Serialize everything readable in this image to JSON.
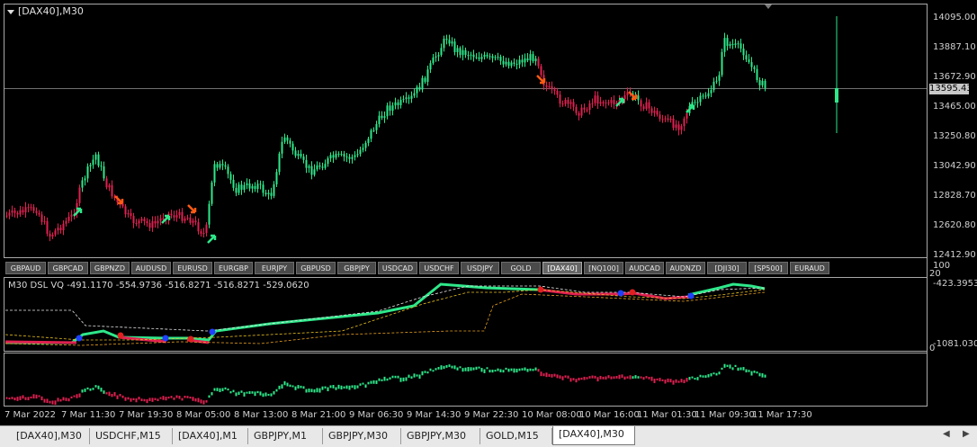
{
  "chart": {
    "title": "[DAX40],M30",
    "price_label": "13595.43",
    "colors": {
      "bull": "#2ee88a",
      "bear": "#e02050",
      "arrow_up": "#2ee88a",
      "arrow_down": "#ff5a14",
      "grid": "#a8a8a8",
      "bg": "#000000"
    }
  },
  "y_axis": {
    "labels": [
      "14095.00",
      "13887.10",
      "13672.90",
      "13465.00",
      "13250.80",
      "13042.90",
      "12828.70",
      "12620.80",
      "12412.90"
    ]
  },
  "symbols": [
    "GBPAUD",
    "GBPCAD",
    "GBPNZD",
    "AUDUSD",
    "EURUSD",
    "EURGBP",
    "EURJPY",
    "GBPUSD",
    "GBPJPY",
    "USDCAD",
    "USDCHF",
    "USDJPY",
    "GOLD",
    "[DAX40]",
    "[NQ100]",
    "AUDCAD",
    "AUDNZD",
    "[DJI30]",
    "[SP500]",
    "EURAUD"
  ],
  "active_symbol": "[DAX40]",
  "indicator": {
    "label": "M30 DSL  VQ -491.1170 -554.9736 -516.8271 -516.8271 -529.0620",
    "axis_top": "100",
    "axis_top_value": "-423.3953",
    "axis_mid": "20",
    "axis_bottom_value": "-1081.0303",
    "bottom_axis_label": "0"
  },
  "x_axis": {
    "labels": [
      "7 Mar 2022",
      "7 Mar 11:30",
      "7 Mar 19:30",
      "8 Mar 05:00",
      "8 Mar 13:00",
      "8 Mar 21:00",
      "9 Mar 06:30",
      "9 Mar 14:30",
      "9 Mar 22:30",
      "10 Mar 08:00",
      "10 Mar 16:00",
      "11 Mar 01:30",
      "11 Mar 09:30",
      "11 Mar 17:30"
    ]
  },
  "tabs": [
    "[DAX40],M30",
    "USDCHF,M15",
    "[DAX40],M1",
    "GBPJPY,M1",
    "GBPJPY,M30",
    "GBPJPY,M30",
    "GOLD,M15",
    "[DAX40],M30"
  ],
  "active_tab_index": 7
}
